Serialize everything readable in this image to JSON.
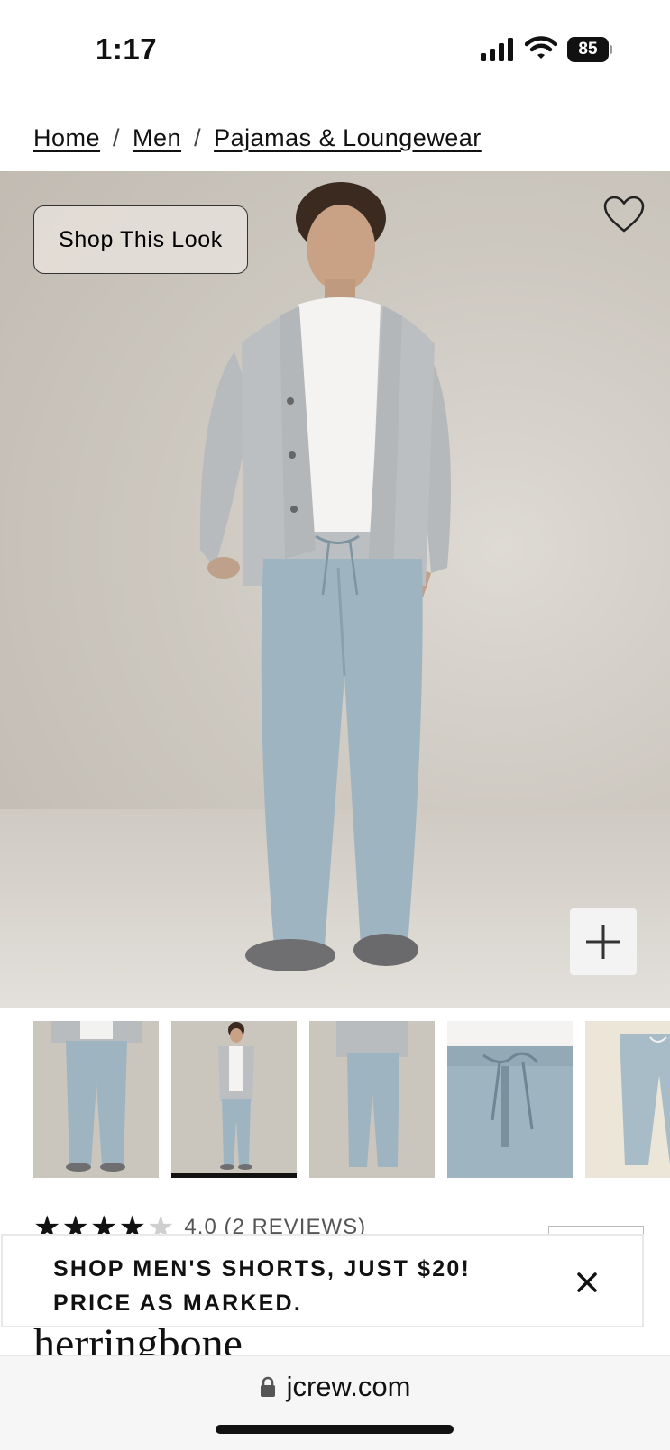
{
  "status_bar": {
    "time": "1:17",
    "battery": "85"
  },
  "breadcrumb": {
    "items": [
      "Home",
      "Men",
      "Pajamas & Loungewear"
    ],
    "separator": "/"
  },
  "hero": {
    "shop_look_label": "Shop This Look",
    "favorite_icon": "heart-icon",
    "zoom_icon": "plus-icon"
  },
  "thumbnails": {
    "count": 5,
    "selected_index": 1
  },
  "rating": {
    "stars_filled": 4,
    "stars_total": 5,
    "text": "4.0 (2 REVIEWS)"
  },
  "promo": {
    "line1": "SHOP MEN'S SHORTS, JUST $20!",
    "line2": "PRICE AS MARKED.",
    "close_icon": "close-icon"
  },
  "product": {
    "name_partial": "herringbone"
  },
  "browser": {
    "url": "jcrew.com"
  },
  "colors": {
    "pant_blue": "#9fb4c1",
    "cardigan_gray": "#b9bcbe",
    "background_taupe": "#cbc6bd"
  }
}
